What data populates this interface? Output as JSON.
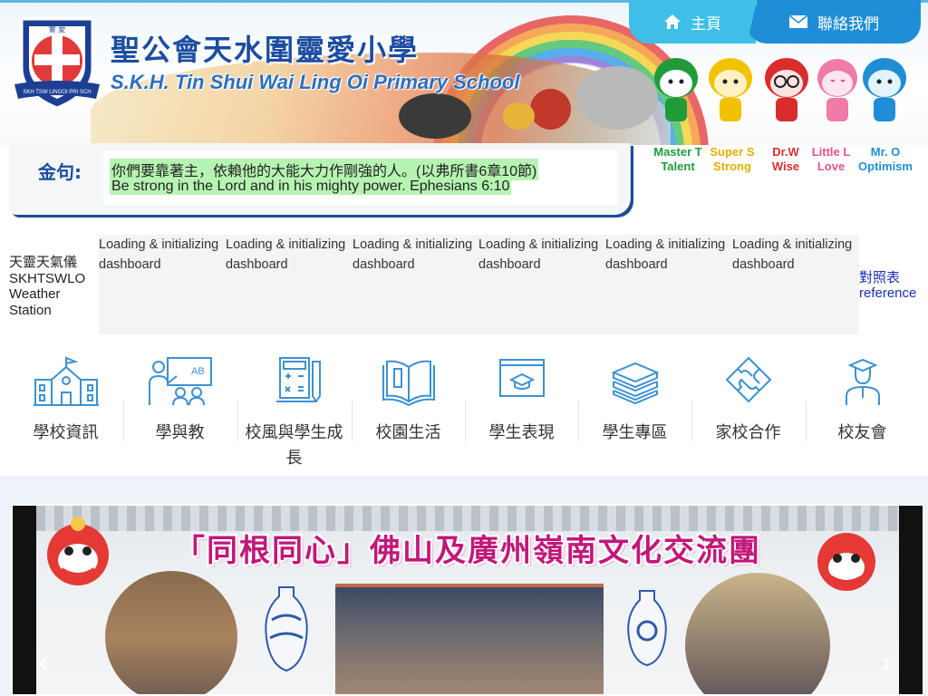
{
  "header": {
    "school_name_cn": "聖公會天水圍靈愛小學",
    "school_name_en": "S.K.H. Tin Shui Wai Ling Oi Primary School",
    "logo_text_top": "靈 愛",
    "logo_text_bottom": "SKH TSW LINGOI PRI SCH",
    "nav": [
      {
        "label": "主頁",
        "icon": "home-icon"
      },
      {
        "label": "聯絡我們",
        "icon": "mail-icon"
      }
    ],
    "mascots": [
      {
        "line1": "Master T",
        "line2": "Talent",
        "color": "#1f9b3a"
      },
      {
        "line1": "Super S",
        "line2": "Strong",
        "color": "#f2c200"
      },
      {
        "line1": "Dr.W",
        "line2": "Wise",
        "color": "#d92d2d"
      },
      {
        "line1": "Little L",
        "line2": "Love",
        "color": "#e8508f"
      },
      {
        "line1": "Mr. O",
        "line2": "Optimism",
        "color": "#1f8ed6"
      }
    ]
  },
  "verse": {
    "label": "金句:",
    "line_cn": "你們要靠著主，依賴他的大能大力作剛強的人。(以弗所書6章10節)",
    "line_en": "Be strong in the Lord and in his mighty power. Ephesians 6:10"
  },
  "weather": {
    "title_lines": [
      "天靈天氣儀",
      "SKHTSWLO",
      "Weather",
      "Station"
    ],
    "loading_line1": "Loading & initializing",
    "loading_line2": "dashboard",
    "reference_lines": [
      "對照表",
      "reference"
    ]
  },
  "menu": [
    {
      "label": "學校資訊",
      "icon": "school-building-icon"
    },
    {
      "label": "學與教",
      "icon": "teacher-board-icon"
    },
    {
      "label": "校風與學生成長",
      "icon": "calculator-icon"
    },
    {
      "label": "校園生活",
      "icon": "open-book-icon"
    },
    {
      "label": "學生表現",
      "icon": "graduation-screen-icon"
    },
    {
      "label": "學生專區",
      "icon": "stacked-books-icon"
    },
    {
      "label": "家校合作",
      "icon": "puzzle-diamond-icon"
    },
    {
      "label": "校友會",
      "icon": "graduate-person-icon"
    }
  ],
  "slider": {
    "slide_title": "「同根同心」佛山及廣州嶺南文化交流團",
    "prev_glyph": "‹",
    "next_glyph": "›"
  },
  "colors": {
    "brand_blue": "#1c4da1",
    "nav_light": "#3dbfe8",
    "nav_dark": "#1f8ed6",
    "verse_highlight": "#b6f4b2",
    "icon_blue": "#3b92d0",
    "slide_title": "#c1187a"
  }
}
